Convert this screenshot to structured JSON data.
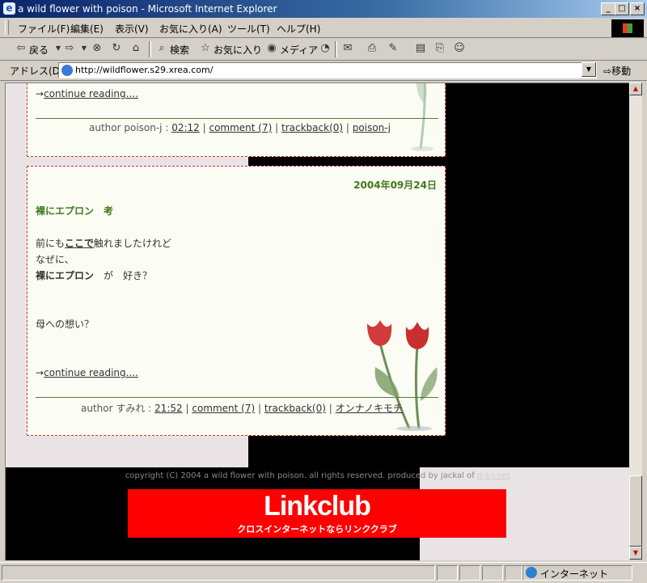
{
  "window": {
    "title": "a wild flower with poison - Microsoft Internet Explorer"
  },
  "menu": [
    "ファイル(F)",
    "編集(E)",
    "表示(V)",
    "お気に入り(A)",
    "ツール(T)",
    "ヘルプ(H)"
  ],
  "toolbar": {
    "back": "戻る",
    "search": "検索",
    "favorites": "お気に入り",
    "media": "メディア"
  },
  "address": {
    "label": "アドレス(D)",
    "url": "http://wildflower.s29.xrea.com/",
    "go": "移動"
  },
  "entries": [
    {
      "continue": "continue reading....",
      "arrow": "→",
      "author_prefix": "author poison-j : ",
      "time": "02:12",
      "comment": "comment (7)",
      "trackback": "trackback(0)",
      "category": "poison-j",
      "sep": "|"
    },
    {
      "date": "2004年09月24日",
      "title": "裸にエプロン　考",
      "line1_pre": "前にも",
      "line1_link": "ここで",
      "line1_post": "触れましたけれど",
      "line2": "なぜに、",
      "line3_bold": "裸にエプロン",
      "line3_rest": "　が　好き？",
      "line4": "母への想い？",
      "arrow": "→",
      "continue": "continue reading....",
      "author_prefix": "author すみれ : ",
      "time": "21:52",
      "comment": "comment (7)",
      "trackback": "trackback(0)",
      "category": "オンナノキモチ",
      "sep": "|"
    }
  ],
  "footer": {
    "copyright": "copyright (C) 2004 a wild flower with poison. all rights reserved. produced by jackal of ",
    "link": "d-s-j.net"
  },
  "banner": {
    "logo": "Linkclub",
    "tagline": "クロスインターネットならリンククラブ"
  },
  "status": {
    "zone": "インターネット"
  },
  "colors": {
    "page_black": "#000000",
    "panel_pink": "#eae3e6",
    "entry_bg": "#fbfcf4",
    "entry_border": "#cc3333",
    "date_green": "#3f7a1d",
    "banner_red": "#ff0000"
  }
}
